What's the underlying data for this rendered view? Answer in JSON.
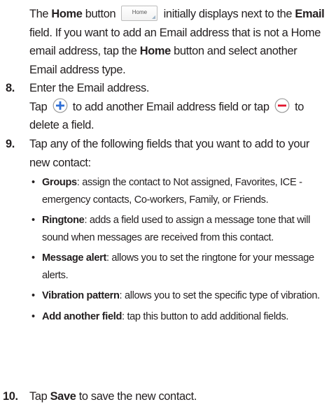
{
  "intro": {
    "part1": "The ",
    "home_bold": "Home",
    "part2": " button ",
    "home_button_label": "Home",
    "part3": " initially displays next to the ",
    "email_bold": "Email",
    "part4": " field. If you want to add an Email address that is not a Home email address, tap the ",
    "home_bold_2": "Home",
    "part5": " button and select another Email address type."
  },
  "step8": {
    "number": "8.",
    "line1": "Enter the Email address.",
    "tap": "Tap ",
    "mid": " to add another Email address field or tap ",
    "end": " to delete a field.",
    "add_icon_color": "#2f6fd6",
    "remove_icon_color": "#e2132b"
  },
  "step9": {
    "number": "9.",
    "text": "Tap any of the following fields that you want to add to your new contact:",
    "bullets": [
      {
        "bullet": "•",
        "term": "Groups",
        "desc": ": assign the contact to Not assigned, Favorites, ICE - emergency contacts, Co-workers, Family, or Friends."
      },
      {
        "bullet": "•",
        "term": "Ringtone",
        "desc": ": adds a field used to assign a message tone that will sound when messages are received from this contact."
      },
      {
        "bullet": "•",
        "term": "Message alert",
        "desc": ": allows you to set the ringtone for your message alerts."
      },
      {
        "bullet": "•",
        "term": "Vibration pattern",
        "desc": ": allows you to set the specific type of vibration."
      },
      {
        "bullet": "•",
        "term": "Add another field",
        "desc": ": tap this button to add additional fields."
      }
    ]
  },
  "step10": {
    "number": "10.",
    "tap": "Tap ",
    "save_bold": "Save",
    "rest": " to save the new contact."
  }
}
